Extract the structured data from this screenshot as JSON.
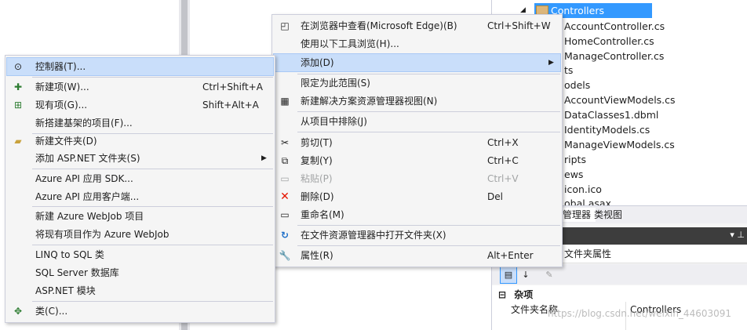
{
  "solution_explorer": {
    "tree": [
      {
        "text": "Controllers",
        "icon": "folder-icon",
        "selected": true
      },
      {
        "text": "AccountController.cs"
      },
      {
        "text": "HomeController.cs"
      },
      {
        "text": "ManageController.cs"
      },
      {
        "text": "ts"
      },
      {
        "text": "odels"
      },
      {
        "text": "AccountViewModels.cs"
      },
      {
        "text": "DataClasses1.dbml"
      },
      {
        "text": "IdentityModels.cs"
      },
      {
        "text": "ManageViewModels.cs"
      },
      {
        "text": "ripts"
      },
      {
        "text": "ews"
      },
      {
        "text": "icon.ico"
      },
      {
        "text": "obal.asax"
      }
    ],
    "tabs": {
      "solution_tab": "管理器",
      "class_view_tab": "类视图"
    },
    "properties": {
      "title": "文件夹属性",
      "category": "杂项",
      "prop_name": "文件夹名称",
      "prop_value": "Controllers"
    },
    "watermark": "https://blog.csdn.net/weixin_44603091"
  },
  "menu_left": {
    "items": [
      {
        "label": "控制器(T)...",
        "icon": "controller-icon",
        "highlighted": true
      },
      {
        "label": "新建项(W)...",
        "shortcut": "Ctrl+Shift+A",
        "icon": "new-item-icon"
      },
      {
        "label": "现有项(G)...",
        "shortcut": "Shift+Alt+A",
        "icon": "existing-item-icon"
      },
      {
        "label": "新搭建基架的项目(F)..."
      },
      {
        "label": "新建文件夹(D)",
        "icon": "new-folder-icon"
      },
      {
        "label": "添加 ASP.NET 文件夹(S)",
        "submenu": true
      },
      {
        "label": "Azure API 应用 SDK..."
      },
      {
        "label": "Azure API 应用客户端..."
      },
      {
        "label": "新建 Azure WebJob 项目"
      },
      {
        "label": "将现有项目作为 Azure WebJob"
      },
      {
        "label": "LINQ to SQL 类"
      },
      {
        "label": "SQL Server 数据库"
      },
      {
        "label": "ASP.NET 模块"
      },
      {
        "label": "类(C)...",
        "icon": "class-icon"
      }
    ]
  },
  "menu_right": {
    "items": [
      {
        "label": "在浏览器中查看(Microsoft Edge)(B)",
        "shortcut": "Ctrl+Shift+W",
        "icon": "browser-icon"
      },
      {
        "label": "使用以下工具浏览(H)..."
      },
      {
        "label": "添加(D)",
        "submenu": true,
        "highlighted": true
      },
      {
        "label": "限定为此范围(S)"
      },
      {
        "label": "新建解决方案资源管理器视图(N)",
        "icon": "new-view-icon"
      },
      {
        "label": "从项目中排除(J)"
      },
      {
        "label": "剪切(T)",
        "shortcut": "Ctrl+X",
        "icon": "cut-icon"
      },
      {
        "label": "复制(Y)",
        "shortcut": "Ctrl+C",
        "icon": "copy-icon"
      },
      {
        "label": "粘贴(P)",
        "shortcut": "Ctrl+V",
        "icon": "paste-icon",
        "disabled": true
      },
      {
        "label": "删除(D)",
        "shortcut": "Del",
        "icon": "delete-icon"
      },
      {
        "label": "重命名(M)",
        "icon": "rename-icon"
      },
      {
        "label": "在文件资源管理器中打开文件夹(X)",
        "icon": "open-folder-icon"
      },
      {
        "label": "属性(R)",
        "shortcut": "Alt+Enter",
        "icon": "wrench-icon"
      }
    ]
  },
  "colors": {
    "highlight": "#c9defa",
    "selection": "#3399ff",
    "delete_icon": "#e51400",
    "menu_bg": "#f5f5f5"
  }
}
